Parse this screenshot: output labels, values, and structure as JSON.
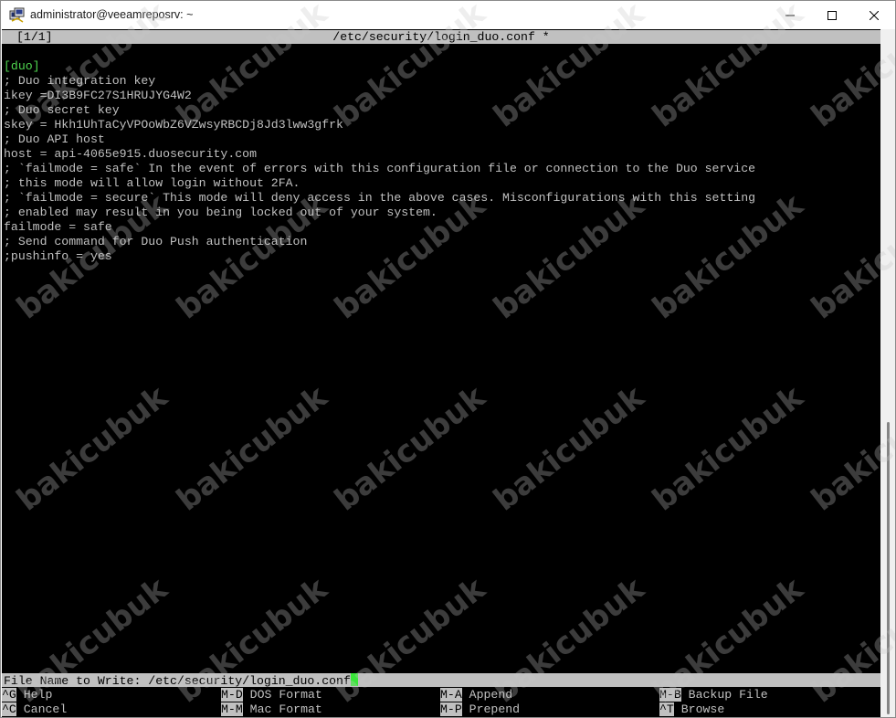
{
  "window": {
    "title": "administrator@veeamreposrv: ~",
    "controls": [
      "minimize",
      "maximize",
      "close"
    ]
  },
  "nano": {
    "header": {
      "position": "[1/1]",
      "filename": "/etc/security/login_duo.conf *"
    },
    "lines": [
      "[duo]",
      "; Duo integration key",
      "ikey =DI3B9FC27S1HRUJYG4W2",
      "; Duo secret key",
      "skey = Hkh1UhTaCyVPOoWbZ6VZwsyRBCDj8Jd3lww3gfrk",
      "; Duo API host",
      "host = api-4065e915.duosecurity.com",
      "; `failmode = safe` In the event of errors with this configuration file or connection to the Duo service",
      "; this mode will allow login without 2FA.",
      "; `failmode = secure` This mode will deny access in the above cases. Misconfigurations with this setting",
      "; enabled may result in you being locked out of your system.",
      "failmode = safe",
      "; Send command for Duo Push authentication",
      ";pushinfo = yes"
    ],
    "prompt": {
      "label": "File Name to Write: ",
      "value": "/etc/security/login_duo.conf"
    },
    "shortcuts": [
      {
        "key": "^G",
        "label": "Help"
      },
      {
        "key": "M-D",
        "label": "DOS Format"
      },
      {
        "key": "M-A",
        "label": "Append"
      },
      {
        "key": "M-B",
        "label": "Backup File"
      },
      {
        "key": "^C",
        "label": "Cancel"
      },
      {
        "key": "M-M",
        "label": "Mac Format"
      },
      {
        "key": "M-P",
        "label": "Prepend"
      },
      {
        "key": "^T",
        "label": "Browse"
      }
    ]
  },
  "watermark": "bakicubuk",
  "colors": {
    "terminal_bg": "#000000",
    "terminal_fg": "#c0c0c0",
    "section_green": "#4fd64f",
    "cursor_green": "#39e639",
    "bar_bg": "#c0c0c0"
  }
}
